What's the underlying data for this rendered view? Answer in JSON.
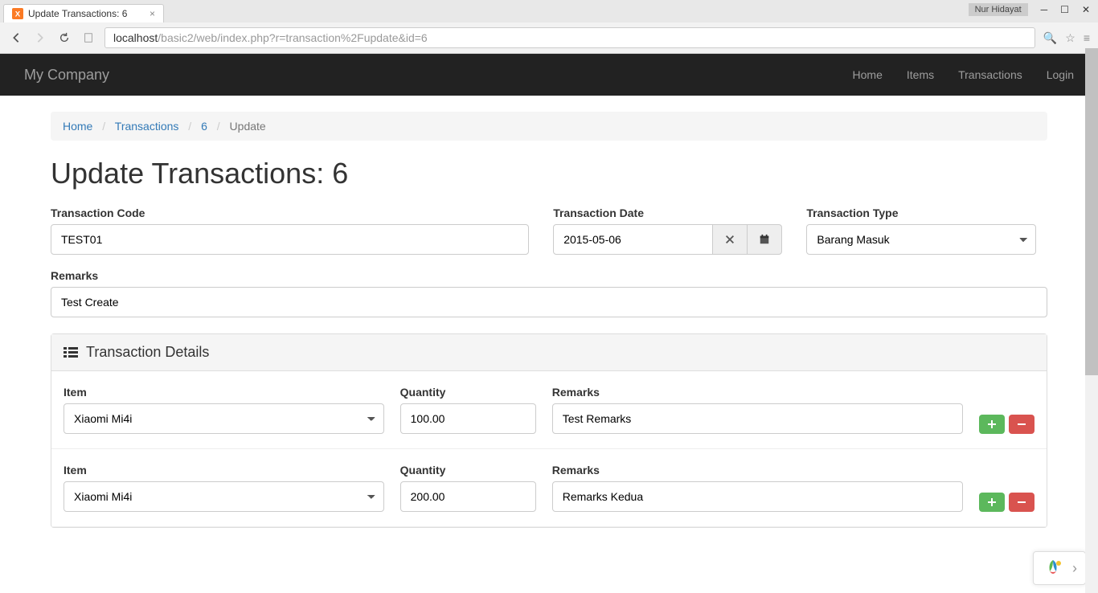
{
  "browser": {
    "tab_title": "Update Transactions: 6",
    "user_badge": "Nur Hidayat",
    "url_host": "localhost",
    "url_path": "/basic2/web/index.php?r=transaction%2Fupdate&id=6"
  },
  "navbar": {
    "brand": "My Company",
    "links": [
      "Home",
      "Items",
      "Transactions",
      "Login"
    ]
  },
  "breadcrumb": {
    "items": [
      {
        "label": "Home",
        "link": true
      },
      {
        "label": "Transactions",
        "link": true
      },
      {
        "label": "6",
        "link": true
      },
      {
        "label": "Update",
        "link": false
      }
    ]
  },
  "page_title": "Update Transactions: 6",
  "form": {
    "transaction_code": {
      "label": "Transaction Code",
      "value": "TEST01"
    },
    "transaction_date": {
      "label": "Transaction Date",
      "value": "2015-05-06"
    },
    "transaction_type": {
      "label": "Transaction Type",
      "value": "Barang Masuk"
    },
    "remarks": {
      "label": "Remarks",
      "value": "Test Create"
    }
  },
  "panel": {
    "title": "Transaction Details",
    "headers": {
      "item": "Item",
      "quantity": "Quantity",
      "remarks": "Remarks"
    },
    "rows": [
      {
        "item": "Xiaomi Mi4i",
        "quantity": "100.00",
        "remarks": "Test Remarks"
      },
      {
        "item": "Xiaomi Mi4i",
        "quantity": "200.00",
        "remarks": "Remarks Kedua"
      }
    ]
  }
}
